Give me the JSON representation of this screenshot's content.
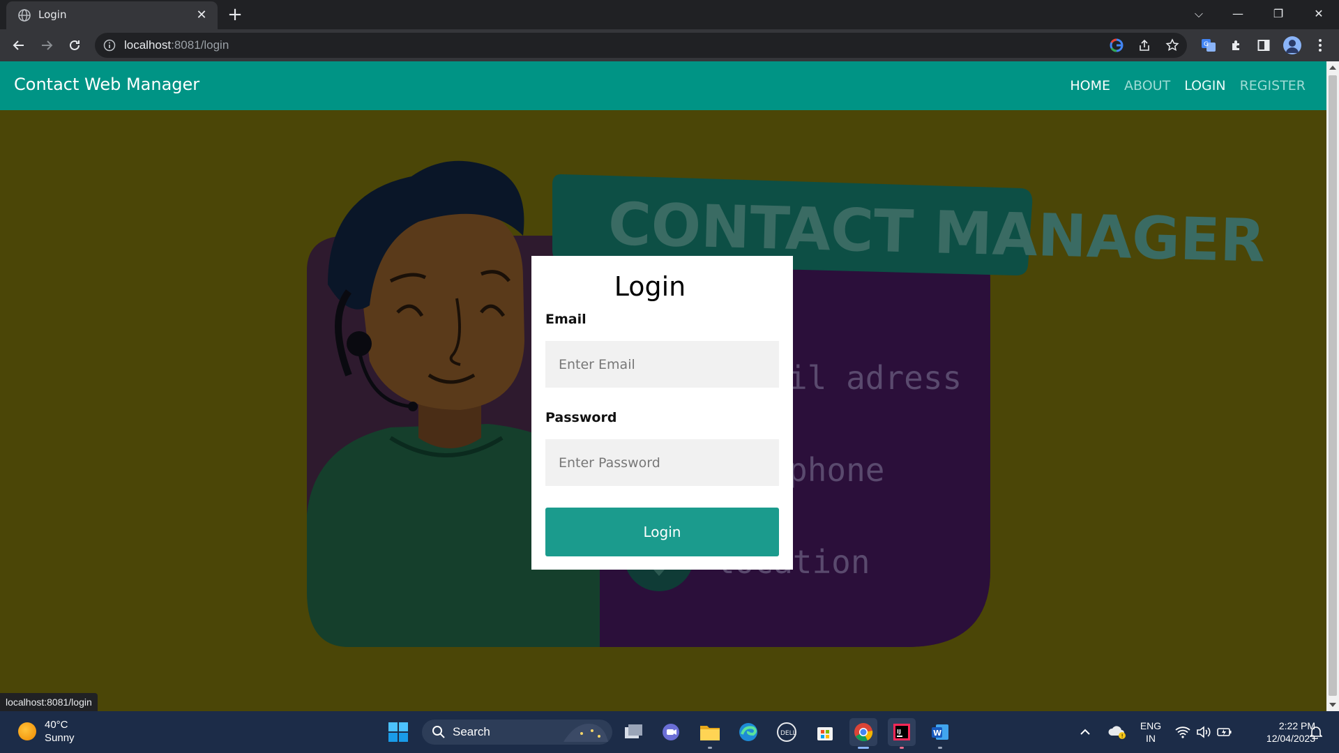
{
  "browser": {
    "tab_title": "Login",
    "url_host": "localhost",
    "url_rest": ":8081/login",
    "status_link": "localhost:8081/login"
  },
  "navbar": {
    "brand": "Contact Web Manager",
    "links": [
      "HOME",
      "ABOUT",
      "LOGIN",
      "REGISTER"
    ]
  },
  "background_art": {
    "sign_text": "CONTACT MANAGER",
    "lines": [
      "il adress",
      "phone",
      "location"
    ]
  },
  "login": {
    "title": "Login",
    "email_label": "Email",
    "email_placeholder": "Enter Email",
    "password_label": "Password",
    "password_placeholder": "Enter Password",
    "submit_label": "Login"
  },
  "taskbar": {
    "weather_temp": "40°C",
    "weather_desc": "Sunny",
    "search_label": "Search",
    "lang_top": "ENG",
    "lang_bottom": "IN",
    "time": "2:22 PM",
    "date": "12/04/2023"
  },
  "colors": {
    "navbar": "#009485",
    "page_bg": "#4b4607",
    "button": "#1b9b8d"
  }
}
